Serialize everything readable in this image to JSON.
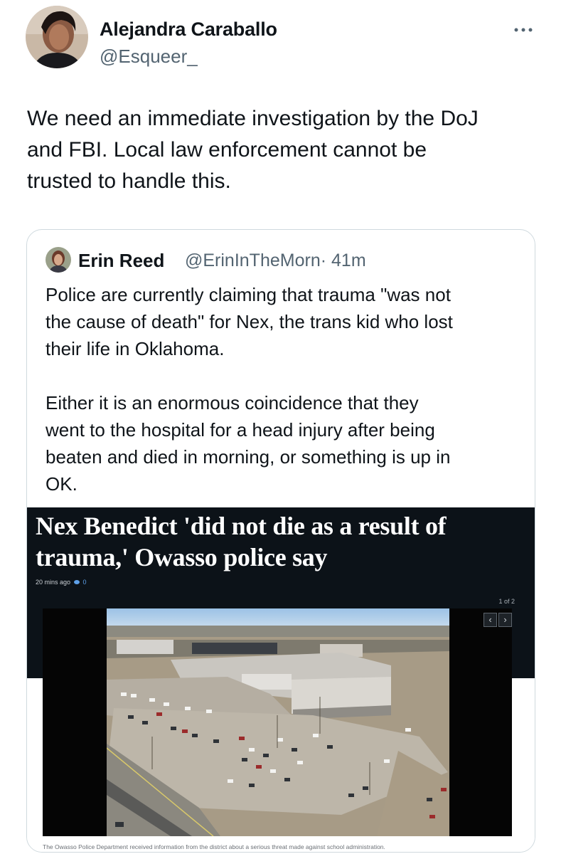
{
  "author": {
    "name": "Alejandra Caraballo",
    "handle": "@Esqueer_"
  },
  "tweet": {
    "text": "We need an immediate investigation by the DoJ\nand FBI. Local law enforcement cannot be\ntrusted to handle this."
  },
  "quote": {
    "name": "Erin Reed",
    "handle": "@ErinInTheMorn",
    "time": "· 41m",
    "text": "Police are currently claiming that trauma \"was not\nthe cause of death\" for Nex, the trans kid who lost\ntheir life in Oklahoma.\n\nEither it is an enormous coincidence that they\nwent to the hospital for a head injury after being\nbeaten and died in morning, or something is up in\nOK."
  },
  "article": {
    "headline": "Nex Benedict 'did not die as a result of trauma,' Owasso police say",
    "time": "20 mins ago",
    "comments": "0",
    "pager": "1 of 2",
    "prev": "‹",
    "next": "›",
    "caption": "The Owasso Police Department received information from the district about a serious threat made against school administration."
  },
  "icons": {
    "more": "more-dots-icon",
    "comment": "comment-bubble-icon"
  },
  "colors": {
    "handle_gray": "#536471",
    "border": "#cfd9de",
    "article_bg": "#0c1218"
  }
}
